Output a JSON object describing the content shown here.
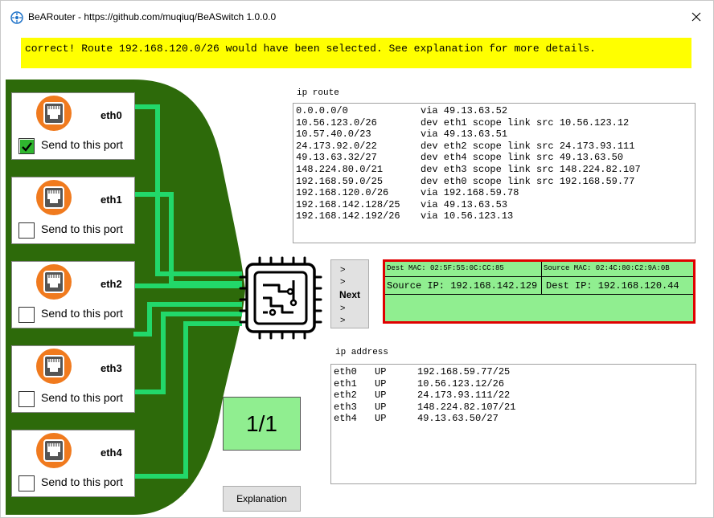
{
  "window": {
    "title": "BeARouter - https://github.com/muqiuq/BeASwitch 1.0.0.0"
  },
  "banner": {
    "message": "correct! Route 192.168.120.0/26 would have been selected. See explanation for more details.",
    "color": "#ffff00"
  },
  "ports": [
    {
      "name": "eth0",
      "label": "Send to this port",
      "checked": true
    },
    {
      "name": "eth1",
      "label": "Send to this port",
      "checked": false
    },
    {
      "name": "eth2",
      "label": "Send to this port",
      "checked": false
    },
    {
      "name": "eth3",
      "label": "Send to this port",
      "checked": false
    },
    {
      "name": "eth4",
      "label": "Send to this port",
      "checked": false
    }
  ],
  "route_table": {
    "label": "ip route",
    "rows": [
      {
        "dest": "0.0.0.0/0",
        "detail": "via 49.13.63.52"
      },
      {
        "dest": "10.56.123.0/26",
        "detail": "dev eth1 scope link src 10.56.123.12"
      },
      {
        "dest": "10.57.40.0/23",
        "detail": "via 49.13.63.51"
      },
      {
        "dest": "24.173.92.0/22",
        "detail": "dev eth2 scope link src 24.173.93.111"
      },
      {
        "dest": "49.13.63.32/27",
        "detail": "dev eth4 scope link src 49.13.63.50"
      },
      {
        "dest": "148.224.80.0/21",
        "detail": "dev eth3 scope link src 148.224.82.107"
      },
      {
        "dest": "192.168.59.0/25",
        "detail": "dev eth0 scope link src 192.168.59.77"
      },
      {
        "dest": "192.168.120.0/26",
        "detail": "via 192.168.59.78"
      },
      {
        "dest": "192.168.142.128/25",
        "detail": "via 49.13.63.53"
      },
      {
        "dest": "192.168.142.192/26",
        "detail": "via 10.56.123.13"
      }
    ]
  },
  "next_button": {
    "arrows": [
      ">",
      ">",
      ">",
      ">"
    ],
    "label": "Next"
  },
  "packet": {
    "dest_mac": "Dest MAC: 02:5F:55:0C:CC:85",
    "source_mac": "Source MAC: 02:4C:80:C2:9A:0B",
    "source_ip": "Source IP: 192.168.142.129",
    "dest_ip": "Dest IP: 192.168.120.44",
    "border_color": "#e00000",
    "fill_color": "#90ee90"
  },
  "address_table": {
    "label": "ip address",
    "rows": [
      {
        "iface": "eth0",
        "state": "UP",
        "addr": "192.168.59.77/25"
      },
      {
        "iface": "eth1",
        "state": "UP",
        "addr": "10.56.123.12/26"
      },
      {
        "iface": "eth2",
        "state": "UP",
        "addr": "24.173.93.111/22"
      },
      {
        "iface": "eth3",
        "state": "UP",
        "addr": "148.224.82.107/21"
      },
      {
        "iface": "eth4",
        "state": "UP",
        "addr": "49.13.63.50/27"
      }
    ]
  },
  "counter": {
    "text": "1/1"
  },
  "explanation_button": {
    "label": "Explanation"
  },
  "colors": {
    "board_green": "#2d6a0a",
    "wire_green": "#22d86a",
    "port_orange": "#f07a1e",
    "counter_green": "#90ee90"
  },
  "icons": {
    "app": "router-app-icon",
    "close": "close-icon",
    "port": "ethernet-port-icon",
    "chip": "cpu-chip-icon",
    "check": "checkmark-icon"
  }
}
